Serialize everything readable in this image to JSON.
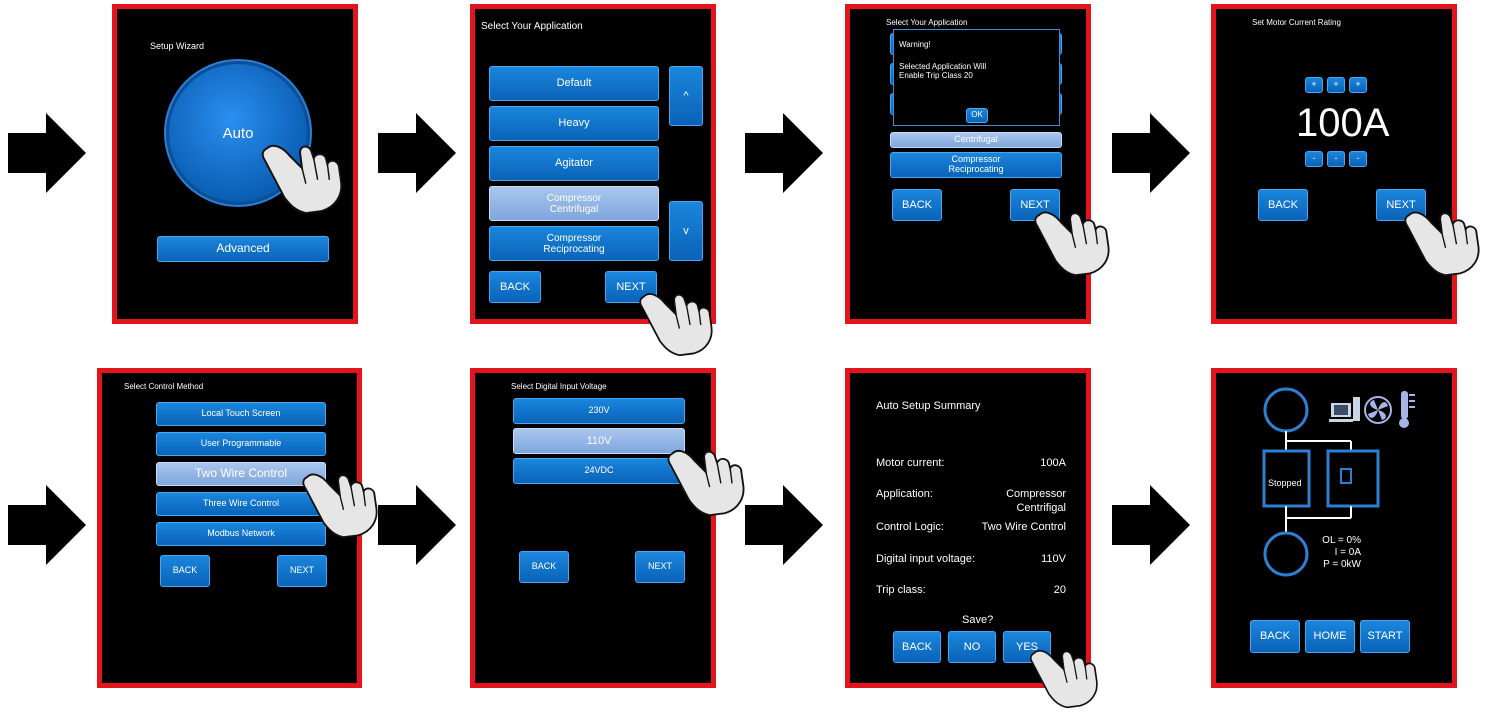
{
  "panel1": {
    "title": "Setup Wizard",
    "auto": "Auto",
    "advanced": "Advanced"
  },
  "panel2": {
    "title": "Select Your Application",
    "items": [
      "Default",
      "Heavy",
      "Agitator",
      "Compressor\nCentrifugal",
      "Compressor\nReciprocating"
    ],
    "up": "^",
    "down": "v",
    "back": "BACK",
    "next": "NEXT"
  },
  "panel3": {
    "title": "Select Your Application",
    "warning_title": "Warning!",
    "warning_msg": "Selected Application Will\nEnable Trip Class 20",
    "ok": "OK",
    "item_centrifugal": "Centrifugal",
    "item_compressor": "Compressor\nReciprocating",
    "back": "BACK",
    "next": "NEXT"
  },
  "panel4": {
    "title": "Set Motor Current Rating",
    "plus": "+",
    "minus": "-",
    "value": "100A",
    "back": "BACK",
    "next": "NEXT"
  },
  "panel5": {
    "title": "Select Control Method",
    "items": [
      "Local Touch Screen",
      "User Programmable",
      "Two Wire Control",
      "Three Wire Control",
      "Modbus Network"
    ],
    "back": "BACK",
    "next": "NEXT"
  },
  "panel6": {
    "title": "Select Digital Input Voltage",
    "items": [
      "230V",
      "110V",
      "24VDC"
    ],
    "back": "BACK",
    "next": "NEXT"
  },
  "panel7": {
    "title": "Auto Setup Summary",
    "motor_label": "Motor current:",
    "motor_value": "100A",
    "app_label": "Application:",
    "app_value": "Compressor\nCentrifigal",
    "logic_label": "Control Logic:",
    "logic_value": "Two Wire Control",
    "voltage_label": "Digital input voltage:",
    "voltage_value": "110V",
    "trip_label": "Trip class:",
    "trip_value": "20",
    "save": "Save?",
    "back": "BACK",
    "no": "NO",
    "yes": "YES"
  },
  "panel8": {
    "status": "Stopped",
    "ol": "OL = 0%",
    "i": "I = 0A",
    "p": "P = 0kW",
    "back": "BACK",
    "home": "HOME",
    "start": "START"
  },
  "colors": {
    "frame": "#e3141b",
    "button": "#0f71c8",
    "selected": "#8eb1e3"
  }
}
